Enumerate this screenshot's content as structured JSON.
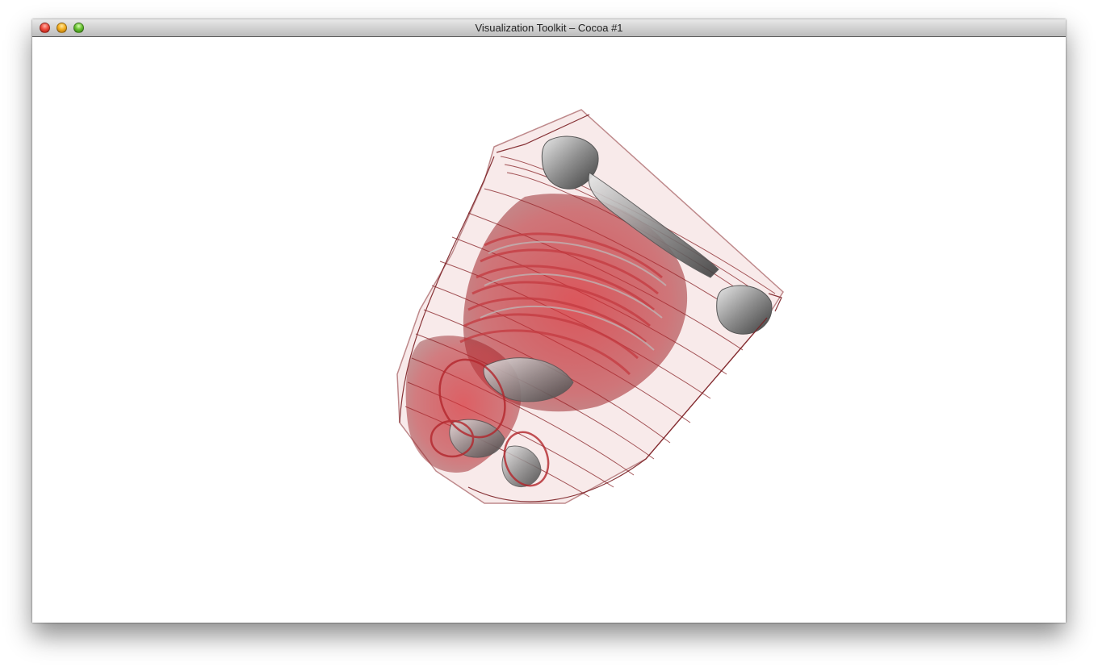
{
  "window": {
    "title": "Visualization Toolkit – Cocoa #1"
  },
  "icons": {
    "close": "close-button-red",
    "minimize": "minimize-button-yellow",
    "zoom": "zoom-button-green"
  },
  "colors": {
    "volume_red": "#b3262c",
    "volume_gray": "#8a8a8a",
    "background": "#ffffff"
  }
}
